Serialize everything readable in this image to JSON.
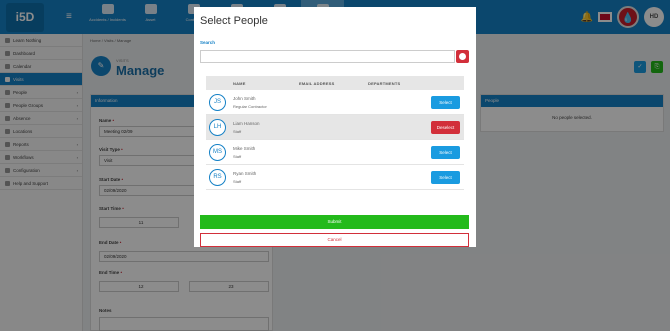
{
  "topbar": {
    "logo": "i5D",
    "nav": [
      {
        "label": "Accidents / Incidents",
        "icon": "accident-icon"
      },
      {
        "label": "Asset",
        "icon": "asset-icon"
      },
      {
        "label": "Contacts",
        "icon": "contacts-icon"
      },
      {
        "label": "",
        "icon": "people-icon"
      },
      {
        "label": "",
        "icon": "visits-icon"
      },
      {
        "label": "",
        "icon": "app-icon"
      }
    ],
    "avatar_initials": "HD"
  },
  "sidebar": {
    "items": [
      {
        "label": "Learn Nothing"
      },
      {
        "label": "Dashboard"
      },
      {
        "label": "Calendar"
      },
      {
        "label": "Visits"
      },
      {
        "label": "People"
      },
      {
        "label": "People Groups"
      },
      {
        "label": "Absence"
      },
      {
        "label": "Locations"
      },
      {
        "label": "Reports"
      },
      {
        "label": "Workflows"
      },
      {
        "label": "Configuration"
      },
      {
        "label": "Help and Support"
      }
    ]
  },
  "breadcrumb": "Home / Visits / Manage",
  "page": {
    "small": "VISITS",
    "title": "Manage"
  },
  "info_panel": {
    "header": "Information",
    "name_label": "Name",
    "name_value": "Meeting 02/09",
    "visit_type_label": "Visit Type",
    "visit_type_value": "Visit",
    "start_date_label": "Start Date",
    "start_date_value": "02/09/2020",
    "start_time_label": "Start Time",
    "start_time_hour": "11",
    "end_date_label": "End Date",
    "end_date_value": "02/09/2020",
    "end_time_label": "End Time",
    "end_time_hour": "12",
    "end_time_min": "23",
    "notes_label": "Notes"
  },
  "people_panel": {
    "header": "People",
    "empty": "No people selected."
  },
  "modal": {
    "title": "Select People",
    "search_label": "Search",
    "columns": [
      "NAME",
      "EMAIL ADDRESS",
      "DEPARTMENTS"
    ],
    "rows": [
      {
        "initials": "JS",
        "name": "John Smith",
        "role": "Regular Contractor",
        "action": "Select",
        "selected": false
      },
      {
        "initials": "LH",
        "name": "Liam Hanson",
        "role": "Staff",
        "action": "Deselect",
        "selected": true
      },
      {
        "initials": "MS",
        "name": "Mike Smith",
        "role": "Staff",
        "action": "Select",
        "selected": false
      },
      {
        "initials": "RS",
        "name": "Ryan Smith",
        "role": "Staff",
        "action": "Select",
        "selected": false
      }
    ],
    "submit": "Submit",
    "cancel": "Cancel"
  },
  "colors": {
    "primary": "#1581c6",
    "danger": "#d22f3a",
    "success": "#23ba1b",
    "select": "#1a9be0"
  }
}
